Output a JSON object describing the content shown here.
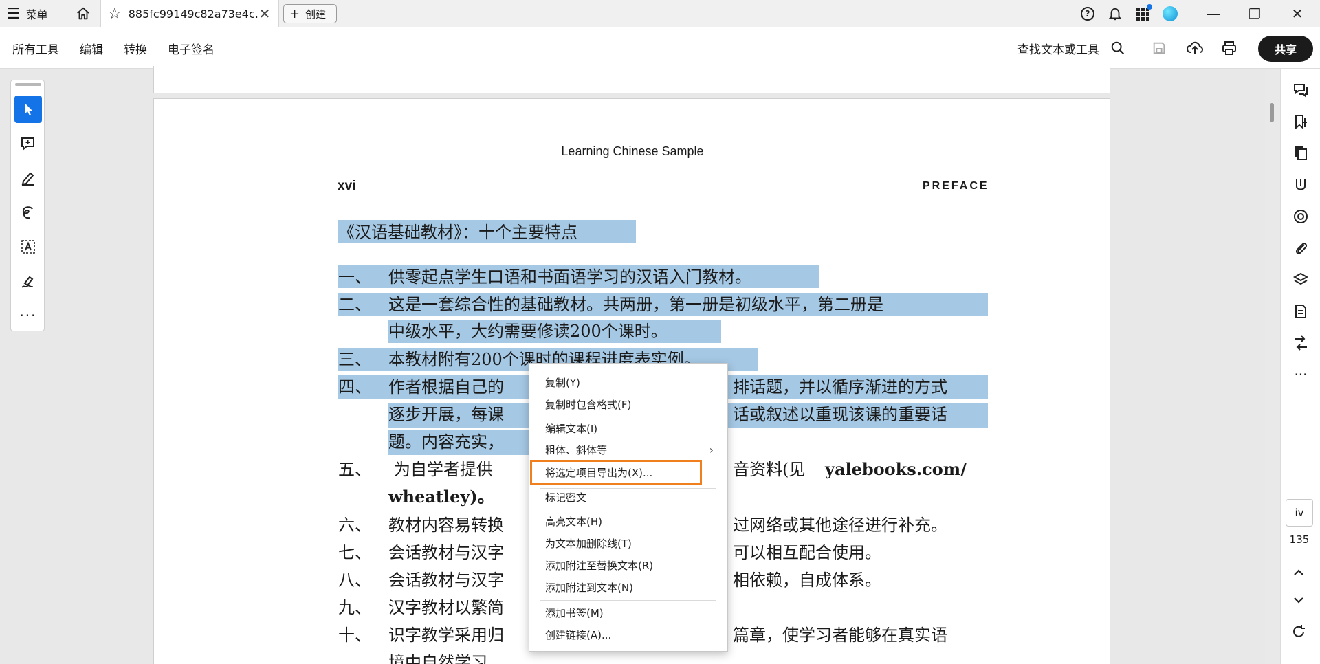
{
  "tabbar": {
    "menu_label": "菜单",
    "tab_title": "885fc99149c82a73e4c...",
    "create_label": "创建"
  },
  "toolbar": {
    "menus": [
      "所有工具",
      "编辑",
      "转换",
      "电子签名"
    ],
    "find_label": "查找文本或工具",
    "share_label": "共享"
  },
  "document": {
    "running_header": "Learning Chinese Sample",
    "page_number": "xvi",
    "section": "PREFACE",
    "heading": "《汉语基础教材》：十个主要特点",
    "items": [
      {
        "num": "一、",
        "lines": [
          "供零起点学生口语和书面语学习的汉语入门教材。"
        ]
      },
      {
        "num": "二、",
        "lines": [
          "这是一套综合性的基础教材。共两册，第一册是初级水平，第二册是",
          "中级水平，大约需要修读200个课时。"
        ]
      },
      {
        "num": "三、",
        "lines": [
          "本教材附有200个课时的课程进度表实例。"
        ]
      },
      {
        "num": "四、",
        "lines": [
          "作者根据自己的",
          "排话题，并以循序渐进的方式",
          "逐步开展，每课",
          "话或叙述以重现该课的重要话",
          "题。内容充实，"
        ]
      },
      {
        "num": "五、",
        "lines": [
          "为自学者提供",
          "音资料(见",
          "yalebooks.com/",
          "wheatley)。"
        ]
      },
      {
        "num": "六、",
        "lines": [
          "教材内容易转换",
          "过网络或其他途径进行补充。"
        ]
      },
      {
        "num": "七、",
        "lines": [
          "会话教材与汉字",
          "可以相互配合使用。"
        ]
      },
      {
        "num": "八、",
        "lines": [
          "会话教材与汉字",
          "相依赖，自成体系。"
        ]
      },
      {
        "num": "九、",
        "lines": [
          "汉字教材以繁简"
        ]
      },
      {
        "num": "十、",
        "lines": [
          "识字教学采用归",
          "篇章，使学习者能够在真实语",
          "境中自然学习"
        ]
      }
    ]
  },
  "context_menu": {
    "items": [
      "复制(Y)",
      "复制时包含格式(F)",
      "编辑文本(I)",
      "粗体、斜体等",
      "将选定项目导出为(X)...",
      "标记密文",
      "高亮文本(H)",
      "为文本加删除线(T)",
      "添加附注至替换文本(R)",
      "添加附注到文本(N)",
      "添加书签(M)",
      "创建链接(A)..."
    ]
  },
  "right_rail": {
    "page_label": "iv",
    "page_total": "135"
  },
  "colors": {
    "accent": "#1473e6",
    "selection": "#a5c8e4",
    "menu_highlight_border": "#f07f1e"
  }
}
